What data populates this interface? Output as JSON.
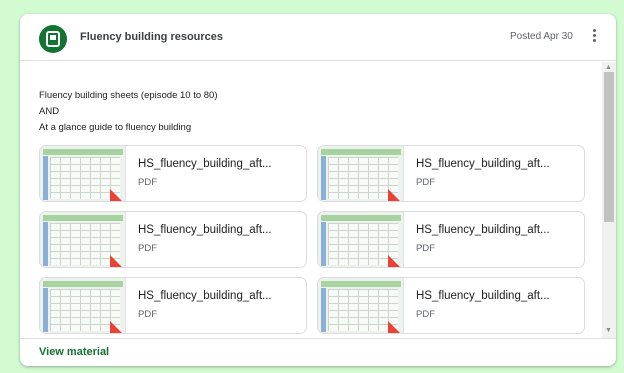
{
  "header": {
    "title": "Fluency building resources",
    "posted": "Posted Apr 30"
  },
  "description": {
    "line1": "Fluency building sheets (episode 10 to 80)",
    "line2": "AND",
    "line3": "At a glance guide to fluency building"
  },
  "attachments": [
    {
      "name": "HS_fluency_building_aft...",
      "type": "PDF"
    },
    {
      "name": "HS_fluency_building_aft...",
      "type": "PDF"
    },
    {
      "name": "HS_fluency_building_aft...",
      "type": "PDF"
    },
    {
      "name": "HS_fluency_building_aft...",
      "type": "PDF"
    },
    {
      "name": "HS_fluency_building_aft...",
      "type": "PDF"
    },
    {
      "name": "HS_fluency_building_aft...",
      "type": "PDF"
    }
  ],
  "footer": {
    "view_material": "View material"
  },
  "colors": {
    "background": "#d2fbd2",
    "accent": "#137333",
    "pdf_badge": "#ea4335"
  },
  "icons": {
    "avatar": "assignment-icon",
    "menu": "more-vert-icon"
  }
}
